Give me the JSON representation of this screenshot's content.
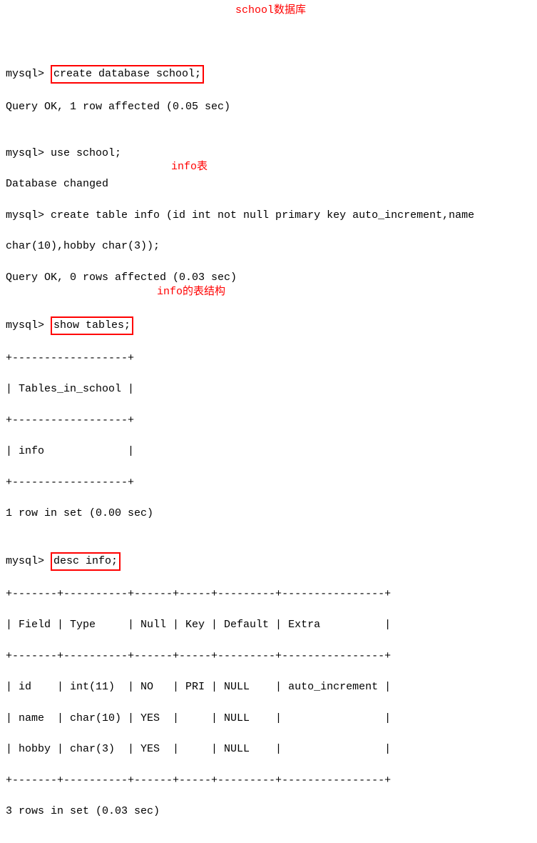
{
  "lines": {
    "l1_prompt": "mysql> ",
    "l1_cmd": "create database school;",
    "l2": "Query OK, 1 row affected (0.05 sec)",
    "l3": "",
    "l4": "mysql> use school;",
    "l5": "Database changed",
    "l6": "mysql> create table info (id int not null primary key auto_increment,name",
    "l7": "char(10),hobby char(3));",
    "l8": "Query OK, 0 rows affected (0.03 sec)",
    "l9": "",
    "l10_prompt": "mysql> ",
    "l10_cmd": "show tables;",
    "l11": "+------------------+",
    "l12": "| Tables_in_school |",
    "l13": "+------------------+",
    "l14": "| info             |",
    "l15": "+------------------+",
    "l16": "1 row in set (0.00 sec)",
    "l17": "",
    "l18_prompt": "mysql> ",
    "l18_cmd": "desc info;",
    "l19": "+-------+----------+------+-----+---------+----------------+",
    "l20": "| Field | Type     | Null | Key | Default | Extra          |",
    "l21": "+-------+----------+------+-----+---------+----------------+",
    "l22": "| id    | int(11)  | NO   | PRI | NULL    | auto_increment |",
    "l23": "| name  | char(10) | YES  |     | NULL    |                |",
    "l24": "| hobby | char(3)  | YES  |     | NULL    |                |",
    "l25": "+-------+----------+------+-----+---------+----------------+",
    "l26": "3 rows in set (0.03 sec)"
  },
  "annotations": {
    "a1": "school数据库",
    "a2": "info表",
    "a3": "info的表结构"
  }
}
